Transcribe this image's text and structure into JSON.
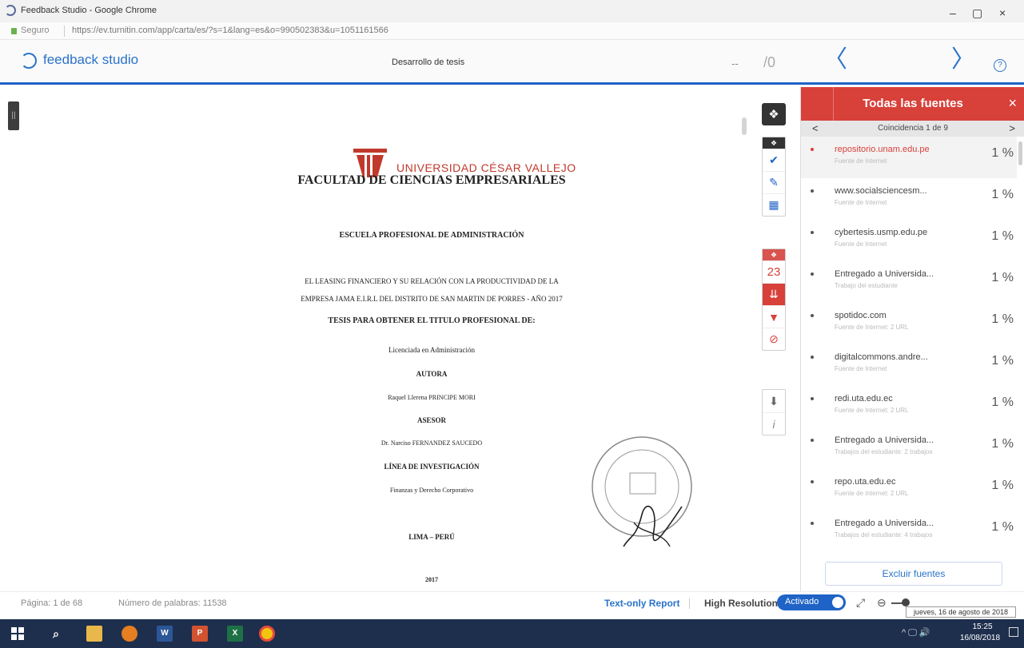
{
  "window": {
    "title": "Feedback Studio - Google Chrome",
    "minimize": "–",
    "maximize": "▢",
    "close": "×"
  },
  "address": {
    "secure_label": "Seguro",
    "url": "https://ev.turnitin.com/app/carta/es/?s=1&lang=es&o=990502383&u=1051161566"
  },
  "header": {
    "brand": "feedback studio",
    "document_title": "Desarrollo de tesis",
    "score_current": "--",
    "score_total": "/0",
    "prev_glyph": "〈",
    "next_glyph": "〉",
    "help_glyph": "?"
  },
  "document": {
    "university": "UNIVERSIDAD CÉSAR VALLEJO",
    "faculty": "FACULTAD DE CIENCIAS EMPRESARIALES",
    "school": "ESCUELA PROFESIONAL DE ADMINISTRACIÓN",
    "topic_line1": "EL LEASING FINANCIERO Y SU RELACIÓN CON LA PRODUCTIVIDAD DE LA",
    "topic_line2": "EMPRESA JAMA E.I.R.L DEL DISTRITO DE SAN MARTIN DE PORRES - AÑO 2017",
    "thesis_heading": "TESIS PARA OBTENER EL TITULO PROFESIONAL DE:",
    "degree": "Licenciada en Administración",
    "author_heading": "AUTORA",
    "author": "Raquel Llerena PRINCIPE MORI",
    "advisor_heading": "ASESOR",
    "advisor": "Dr. Narciso FERNANDEZ SAUCEDO",
    "research_line_heading": "LÍNEA DE INVESTIGACIÓN",
    "research_line": "Finanzas y Derecho Corporativo",
    "city": "LIMA – PERÚ",
    "year": "2017"
  },
  "toolbar": {
    "layers_glyph": "❖",
    "check_glyph": "✔",
    "edit_glyph": "✎",
    "grid_glyph": "▦",
    "match_count": "23",
    "sort_glyph": "⇊",
    "filter_glyph": "▼",
    "exclude_glyph": "⊘",
    "download_glyph": "⬇",
    "info_glyph": "i"
  },
  "panel": {
    "title": "Todas las fuentes",
    "close_glyph": "×",
    "match_prev": "<",
    "match_next": ">",
    "match_label": "Coincidencia 1 de 9",
    "sources": [
      {
        "name": "repositorio.unam.edu.pe",
        "kind": "Fuente de Internet",
        "pct": "1 %"
      },
      {
        "name": "www.socialsciencesm...",
        "kind": "Fuente de Internet",
        "pct": "1 %"
      },
      {
        "name": "cybertesis.usmp.edu.pe",
        "kind": "Fuente de Internet",
        "pct": "1 %"
      },
      {
        "name": "Entregado a Universida...",
        "kind": "Trabajo del estudiante",
        "pct": "1 %"
      },
      {
        "name": "spotidoc.com",
        "kind": "Fuente de Internet: 2 URL",
        "pct": "1 %"
      },
      {
        "name": "digitalcommons.andre...",
        "kind": "Fuente de Internet",
        "pct": "1 %"
      },
      {
        "name": "redi.uta.edu.ec",
        "kind": "Fuente de Internet: 2 URL",
        "pct": "1 %"
      },
      {
        "name": "Entregado a Universida...",
        "kind": "Trabajos del estudiante: 2 trabajos",
        "pct": "1 %"
      },
      {
        "name": "repo.uta.edu.ec",
        "kind": "Fuente de Internet: 2 URL",
        "pct": "1 %"
      },
      {
        "name": "Entregado a Universida...",
        "kind": "Trabajos del estudiante: 4 trabajos",
        "pct": "1 %"
      }
    ],
    "exclude_button": "Excluir fuentes"
  },
  "status": {
    "page": "Página: 1 de 68",
    "words": "Número de palabras: 11538",
    "text_only": "Text-only Report",
    "high_res": "High Resolution",
    "toggle_label": "Activado",
    "tooltip": "jueves, 16 de agosto de 2018"
  },
  "taskbar": {
    "time": "15:25",
    "date": "16/08/2018",
    "tray": "^ 🖵 🔊"
  },
  "colors": {
    "brand_blue": "#2a73c9",
    "panel_red": "#d8403a",
    "taskbar": "#1e2f4d"
  }
}
